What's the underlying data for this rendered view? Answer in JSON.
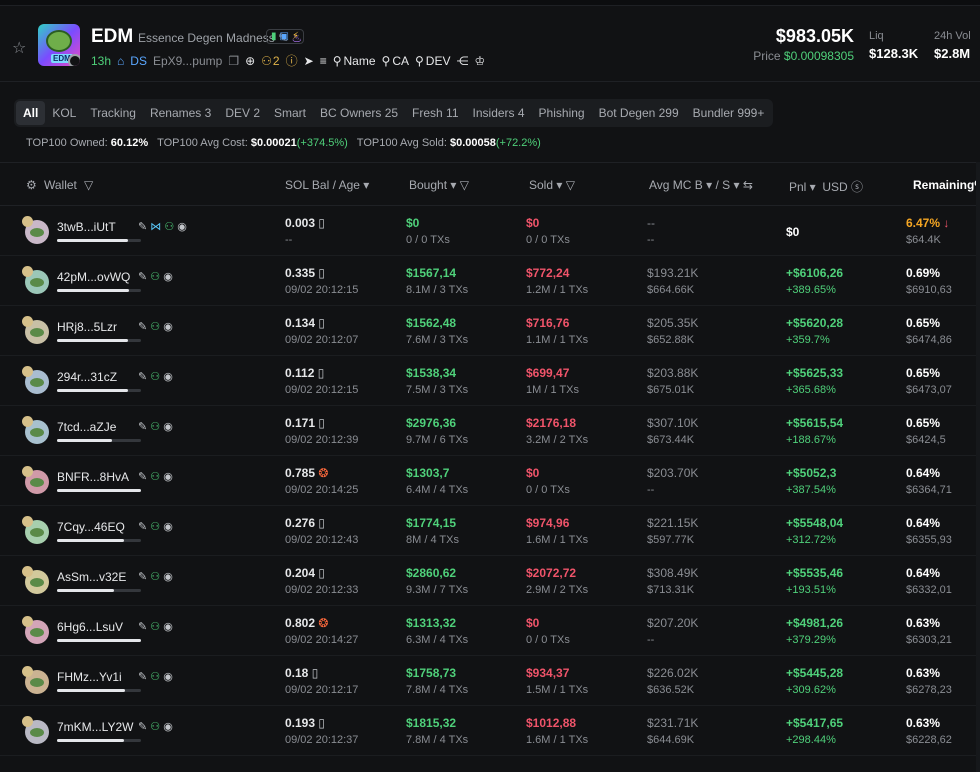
{
  "token": {
    "symbol": "EDM",
    "name": "Essence Degen Madness",
    "age": "13h",
    "ds": "DS",
    "address": "EpX9...pump",
    "holders_count": "2",
    "links": [
      "Name",
      "CA",
      "DEV"
    ],
    "logo_tag": "EDM"
  },
  "market": {
    "mcap": "$983.05K",
    "price_label": "Price",
    "price": "$0.00098305",
    "liq_label": "Liq",
    "liq": "$128.3K",
    "vol_label": "24h Vol",
    "vol": "$2.8M"
  },
  "tabs": [
    "All",
    "KOL",
    "Tracking",
    "Renames 3",
    "DEV 2",
    "Smart",
    "BC Owners 25",
    "Fresh 11",
    "Insiders 4",
    "Phishing",
    "Bot Degen 299",
    "Bundler 999+"
  ],
  "stats": {
    "owned_label": "TOP100 Owned:",
    "owned": "60.12%",
    "avg_cost_label": "TOP100 Avg Cost:",
    "avg_cost": "$0.00021",
    "avg_cost_change": "(+374.5%)",
    "avg_sold_label": "TOP100 Avg Sold:",
    "avg_sold": "$0.00058",
    "avg_sold_change": "(+72.2%)"
  },
  "columns": {
    "wallet": "Wallet",
    "sol_bal": "SOL Bal",
    "age": "/ Age",
    "bought": "Bought",
    "sold": "Sold",
    "avg_mc": "Avg MC B",
    "avg_mc_s": "/ S",
    "pnl": "Pnl",
    "usd": "USD",
    "remaining": "Remaining%"
  },
  "rows": [
    {
      "wallet": "3twB...iUtT",
      "bal": "0.003",
      "age": "--",
      "bought": "$0",
      "bought_tx": "0 / 0 TXs",
      "sold": "$0",
      "sold_tx": "0 / 0 TXs",
      "mcb": "--",
      "mcs": "--",
      "pnl": "$0",
      "pnl_pct": "",
      "rem": "6.47%",
      "rem_usd": "$64.4K",
      "bar": 0.85,
      "rem_down": true,
      "pnl_zero": true
    },
    {
      "wallet": "42pM...ovWQ",
      "bal": "0.335",
      "age": "09/02 20:12:15",
      "bought": "$1567,14",
      "bought_tx": "8.1M / 3 TXs",
      "sold": "$772,24",
      "sold_tx": "1.2M / 1 TXs",
      "mcb": "$193.21K",
      "mcs": "$664.66K",
      "pnl": "+$6106,26",
      "pnl_pct": "+389.65%",
      "rem": "0.69%",
      "rem_usd": "$6910,63",
      "bar": 0.86
    },
    {
      "wallet": "HRj8...5Lzr",
      "bal": "0.134",
      "age": "09/02 20:12:07",
      "bought": "$1562,48",
      "bought_tx": "7.6M / 3 TXs",
      "sold": "$716,76",
      "sold_tx": "1.1M / 1 TXs",
      "mcb": "$205.35K",
      "mcs": "$652.88K",
      "pnl": "+$5620,28",
      "pnl_pct": "+359.7%",
      "rem": "0.65%",
      "rem_usd": "$6474,86",
      "bar": 0.85
    },
    {
      "wallet": "294r...31cZ",
      "bal": "0.112",
      "age": "09/02 20:12:15",
      "bought": "$1538,34",
      "bought_tx": "7.5M / 3 TXs",
      "sold": "$699,47",
      "sold_tx": "1M / 1 TXs",
      "mcb": "$203.88K",
      "mcs": "$675.01K",
      "pnl": "+$5625,33",
      "pnl_pct": "+365.68%",
      "rem": "0.65%",
      "rem_usd": "$6473,07",
      "bar": 0.85
    },
    {
      "wallet": "7tcd...aZJe",
      "bal": "0.171",
      "age": "09/02 20:12:39",
      "bought": "$2976,36",
      "bought_tx": "9.7M / 6 TXs",
      "sold": "$2176,18",
      "sold_tx": "3.2M / 2 TXs",
      "mcb": "$307.10K",
      "mcs": "$673.44K",
      "pnl": "+$5615,54",
      "pnl_pct": "+188.67%",
      "rem": "0.65%",
      "rem_usd": "$6424,5",
      "bar": 0.66
    },
    {
      "wallet": "BNFR...8HvA",
      "bal": "0.785",
      "age": "09/02 20:14:25",
      "bought": "$1303,7",
      "bought_tx": "6.4M / 4 TXs",
      "sold": "$0",
      "sold_tx": "0 / 0 TXs",
      "mcb": "$203.70K",
      "mcs": "--",
      "pnl": "+$5052,3",
      "pnl_pct": "+387.54%",
      "rem": "0.64%",
      "rem_usd": "$6364,71",
      "bar": 1.0,
      "fire": true
    },
    {
      "wallet": "7Cqy...46EQ",
      "bal": "0.276",
      "age": "09/02 20:12:43",
      "bought": "$1774,15",
      "bought_tx": "8M / 4 TXs",
      "sold": "$974,96",
      "sold_tx": "1.6M / 1 TXs",
      "mcb": "$221.15K",
      "mcs": "$597.77K",
      "pnl": "+$5548,04",
      "pnl_pct": "+312.72%",
      "rem": "0.64%",
      "rem_usd": "$6355,93",
      "bar": 0.8
    },
    {
      "wallet": "AsSm...v32E",
      "bal": "0.204",
      "age": "09/02 20:12:33",
      "bought": "$2860,62",
      "bought_tx": "9.3M / 7 TXs",
      "sold": "$2072,72",
      "sold_tx": "2.9M / 2 TXs",
      "mcb": "$308.49K",
      "mcs": "$713.31K",
      "pnl": "+$5535,46",
      "pnl_pct": "+193.51%",
      "rem": "0.64%",
      "rem_usd": "$6332,01",
      "bar": 0.68
    },
    {
      "wallet": "6Hg6...LsuV",
      "bal": "0.802",
      "age": "09/02 20:14:27",
      "bought": "$1313,32",
      "bought_tx": "6.3M / 4 TXs",
      "sold": "$0",
      "sold_tx": "0 / 0 TXs",
      "mcb": "$207.20K",
      "mcs": "--",
      "pnl": "+$4981,26",
      "pnl_pct": "+379.29%",
      "rem": "0.63%",
      "rem_usd": "$6303,21",
      "bar": 1.0,
      "fire": true
    },
    {
      "wallet": "FHMz...Yv1i",
      "bal": "0.18",
      "age": "09/02 20:12:17",
      "bought": "$1758,73",
      "bought_tx": "7.8M / 4 TXs",
      "sold": "$934,37",
      "sold_tx": "1.5M / 1 TXs",
      "mcb": "$226.02K",
      "mcs": "$636.52K",
      "pnl": "+$5445,28",
      "pnl_pct": "+309.62%",
      "rem": "0.63%",
      "rem_usd": "$6278,23",
      "bar": 0.81
    },
    {
      "wallet": "7mKM...LY2W",
      "bal": "0.193",
      "age": "09/02 20:12:37",
      "bought": "$1815,32",
      "bought_tx": "7.8M / 4 TXs",
      "sold": "$1012,88",
      "sold_tx": "1.6M / 1 TXs",
      "mcb": "$231.71K",
      "mcs": "$644.69K",
      "pnl": "+$5417,65",
      "pnl_pct": "+298.44%",
      "rem": "0.63%",
      "rem_usd": "$6228,62",
      "bar": 0.8
    }
  ]
}
